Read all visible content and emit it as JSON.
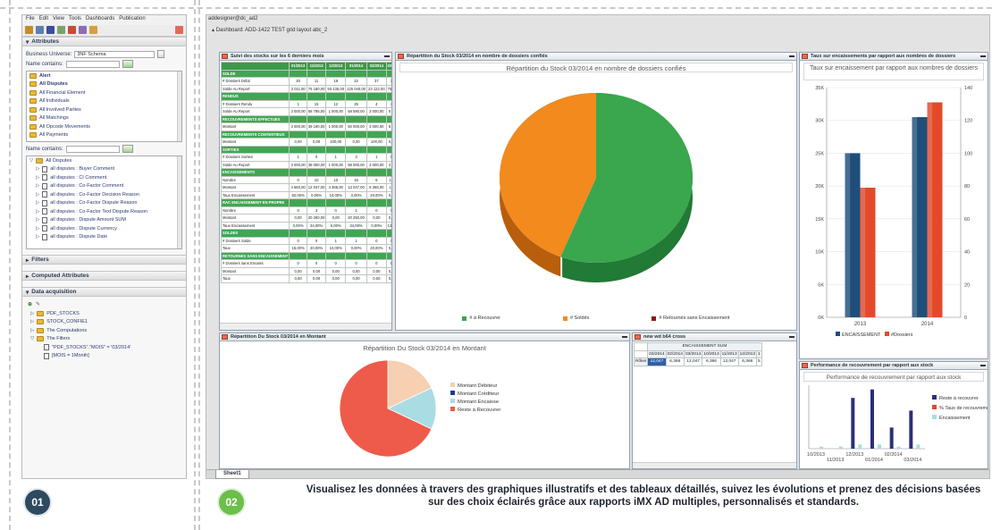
{
  "left_panel": {
    "menu": [
      "File",
      "Edit",
      "View",
      "Tools",
      "Dashboards",
      "Publication"
    ],
    "attributes_title": "Attributes",
    "business_universe_label": "Business Universe:",
    "business_universe_value": "3NF Schema",
    "name_contains_label": "Name contains:",
    "universe_items": [
      "Alert",
      "All Disputes",
      "All Financial Element",
      "All Individuals",
      "All Involved Parties",
      "All Matchings",
      "All Opcode Movements",
      "All Payments"
    ],
    "tree_root": "All Disputes",
    "tree_items": [
      "all disputes : Buyer Comment",
      "all disputes : CI Comment",
      "all disputes : Co-Factor Comment",
      "all disputes : Co-Factor Decision Reason",
      "all disputes : Co-Factor Dispute Reason",
      "all disputes : Co-Factor Text Dispute Reason",
      "all disputes : Dispute Amount SUM",
      "all disputes : Dispute Currency",
      "all disputes : Dispute Date"
    ],
    "filters_title": "Filters",
    "computed_title": "Computed Attributes",
    "data_acq_title": "Data acquisition",
    "acq_items": [
      "PDF_STOCKS",
      "STOCK_CONFIE1",
      "The Computations",
      "The Filters"
    ],
    "filter_conditions": [
      "\"PDF_STOCKS\".\"MOIS\" = '03/2014'",
      "[MOIS = 1Month]"
    ]
  },
  "dashboard": {
    "user": "addesigner@dc_ad2",
    "tab_label": "Dashboard: ADD-1422 TEST grid layout abc_2",
    "sheet_tab": "Sheet1",
    "windows": {
      "table": "Suivi des stocks sur les 6 derniers mois",
      "pie3d": "Répartition du Stock 03/2014 en nombre de dossiers confiés",
      "bars": "Taux sur encaissements par rapport aux nombres de dossiers",
      "pie2": "Répartition Du Stock 03/2014 en Montant",
      "cross": "new wd b64 cross",
      "perf": "Performance de recouvrement par rapport aux stock"
    }
  },
  "stock_table": {
    "headers": [
      "",
      "01/2013",
      "11/2013",
      "12/2013",
      "01/2014",
      "02/2014",
      "03/2"
    ],
    "rows": [
      {
        "group": true,
        "label": "SOLDE"
      },
      {
        "label": "# Dossiers Débit",
        "cells": [
          "30",
          "11",
          "19",
          "22",
          "37",
          "3"
        ]
      },
      {
        "label": "Solde Au Report",
        "cells": [
          "3 011,00",
          "75 180,00",
          "93 135,00",
          "125 040,00",
          "23 122,00",
          "75 0"
        ]
      },
      {
        "group": true,
        "label": "RENDUS"
      },
      {
        "label": "# Dossiers Rendu",
        "cells": [
          "1",
          "15",
          "12",
          "25",
          "4",
          "4"
        ]
      },
      {
        "label": "Solde Au Report",
        "cells": [
          "3 000,00",
          "56 785,00",
          "1 000,00",
          "58 590,00",
          "3 000,00",
          "5 0"
        ]
      },
      {
        "group": true,
        "label": "RECOUVREMENTS EFFECTUES"
      },
      {
        "label": "Montant",
        "cells": [
          "3 000,00",
          "39 190,00",
          "1 000,00",
          "50 000,00",
          "3 000,00",
          "5 0"
        ]
      },
      {
        "group": true,
        "label": "RECOUVREMENTS CONTENTIEUX"
      },
      {
        "label": "Montant",
        "cells": [
          "0,00",
          "0,00",
          "100,00",
          "0,00",
          "100,00",
          "0,0"
        ]
      },
      {
        "group": true,
        "label": "SORTIES"
      },
      {
        "label": "# Dossiers Sorties",
        "cells": [
          "1",
          "0",
          "1",
          "3",
          "1",
          "0"
        ]
      },
      {
        "label": "Solde Au Report",
        "cells": [
          "3 000,00",
          "38 000,00",
          "1 000,00",
          "58 000,00",
          "3 000,00",
          "3 0"
        ]
      },
      {
        "group": true,
        "label": "ENCAISSEMENTS"
      },
      {
        "label": "Nombre",
        "cells": [
          "0",
          "10",
          "10",
          "15",
          "6",
          "12"
        ]
      },
      {
        "label": "Montant",
        "cells": [
          "4 560,00",
          "12 047,00",
          "4 366,00",
          "13 047,00",
          "6 366,00",
          "12"
        ]
      },
      {
        "label": "Taux Encaissement",
        "cells": [
          "92,00%",
          "0,00%",
          "10,00%",
          "0,00%",
          "20,00%",
          "0,0"
        ]
      },
      {
        "group": true,
        "label": "RAC ENCAISSEMENT EN PROPRE"
      },
      {
        "label": "Nombre",
        "cells": [
          "0",
          "3",
          "0",
          "1",
          "0",
          "0"
        ]
      },
      {
        "label": "Montant",
        "cells": [
          "0,00",
          "20 250,00",
          "0,00",
          "20 250,00",
          "0,00",
          "0,0"
        ]
      },
      {
        "label": "Taux Encaissement",
        "cells": [
          "0,00%",
          "34,00%",
          "0,00%",
          "34,00%",
          "0,00%",
          "13,0"
        ]
      },
      {
        "group": true,
        "label": "SOLDES"
      },
      {
        "label": "# Dossiers Solde",
        "cells": [
          "0",
          "0",
          "1",
          "1",
          "0",
          "0"
        ]
      },
      {
        "label": "Taux",
        "cells": [
          "15,00%",
          "20,00%",
          "10,00%",
          "0,00%",
          "20,00%",
          "0,0"
        ]
      },
      {
        "group": true,
        "label": "RETOURNES SANS ENCAISSEMENT"
      },
      {
        "label": "# Dossiers sans Encaiss",
        "cells": [
          "0",
          "0",
          "0",
          "0",
          "0",
          "0"
        ]
      },
      {
        "label": "Montant",
        "cells": [
          "0,00",
          "0,00",
          "0,00",
          "0,00",
          "0,00",
          "0,0"
        ]
      },
      {
        "label": "Taux",
        "cells": [
          "0,00",
          "0,00",
          "0,00",
          "0,00",
          "0,00",
          "0,0"
        ]
      }
    ]
  },
  "chart_data": [
    {
      "type": "pie",
      "title": "Répartition du Stock 03/2014 en nombre de dossiers confiés",
      "labels": [
        "# à Recouvrer",
        "# Soldés",
        "# Retournés sans Encaissement"
      ],
      "values": [
        56,
        44,
        0
      ],
      "colors": [
        "#3aa64e",
        "#f28a1e",
        "#8b1a1a"
      ],
      "legend": "bottom"
    },
    {
      "type": "bar",
      "title": "Taux sur encaissement par rapport aux nombres de dossiers",
      "categories": [
        "2013",
        "2014"
      ],
      "series": [
        {
          "name": "ENCAISSEMENT",
          "axis": "left",
          "values": [
            25000,
            30500
          ],
          "color": "#1f4e7a"
        },
        {
          "name": "#Dossiers",
          "axis": "right",
          "values": [
            79,
            131
          ],
          "color": "#e24a2a"
        }
      ],
      "y_left_ticks": [
        "0K",
        "5K",
        "10K",
        "15K",
        "20K",
        "25K",
        "30K",
        "35K"
      ],
      "y_right_ticks": [
        "0",
        "20",
        "40",
        "60",
        "80",
        "100",
        "120",
        "140"
      ],
      "ylim_left": [
        0,
        35000
      ],
      "ylim_right": [
        0,
        140
      ],
      "legend": "bottom"
    },
    {
      "type": "pie",
      "title": "Répartition Du Stock 03/2014 en Montant",
      "labels": [
        "Montant Débiteur",
        "Montant Créditeur",
        "Montant Encaisse",
        "Reste à Recouvrer"
      ],
      "values": [
        18,
        0,
        14,
        68
      ],
      "colors": [
        "#f6d0b0",
        "#1f3a8a",
        "#a9dce3",
        "#ef5b4a"
      ],
      "legend": "right"
    },
    {
      "type": "bar",
      "title": "Performance de recouvrement par rapport aux stock",
      "categories": [
        "10/2013",
        "11/2013",
        "12/2013",
        "01/2014",
        "02/2014",
        "03/2014"
      ],
      "series": [
        {
          "name": "Reste à recouvrer",
          "values": [
            0,
            0,
            12,
            14,
            5,
            9
          ],
          "color": "#2b2f7a"
        },
        {
          "name": "% Taux de recouvrement",
          "values": [
            0,
            0,
            0,
            0,
            0,
            0
          ],
          "color": "#e24a2a"
        },
        {
          "name": "Encaissement",
          "values": [
            0.5,
            0.5,
            1,
            1,
            0.5,
            1
          ],
          "color": "#a9dce3"
        }
      ],
      "legend": "right"
    }
  ],
  "cross_table": {
    "header": "ENCAISSEMENT SUM",
    "columns": [
      "03/2014",
      "02/2014",
      "03/2014",
      "10/2013",
      "11/2013",
      "12/2013",
      "1"
    ],
    "row_label": "Rôles",
    "values": [
      "12,047",
      "6,366",
      "12,047",
      "6,366",
      "12,047",
      "6,366",
      "5"
    ]
  },
  "footer": {
    "step1": "01",
    "step2": "02",
    "caption": "Visualisez les données à travers des graphiques illustratifs et des tableaux détaillés, suivez les évolutions et prenez des décisions basées sur des choix éclairés grâce aux rapports iMX AD multiples, personnalisés et standards.",
    "colors": {
      "step1": "#2f4a5f",
      "step2": "#6bbf4a"
    }
  }
}
